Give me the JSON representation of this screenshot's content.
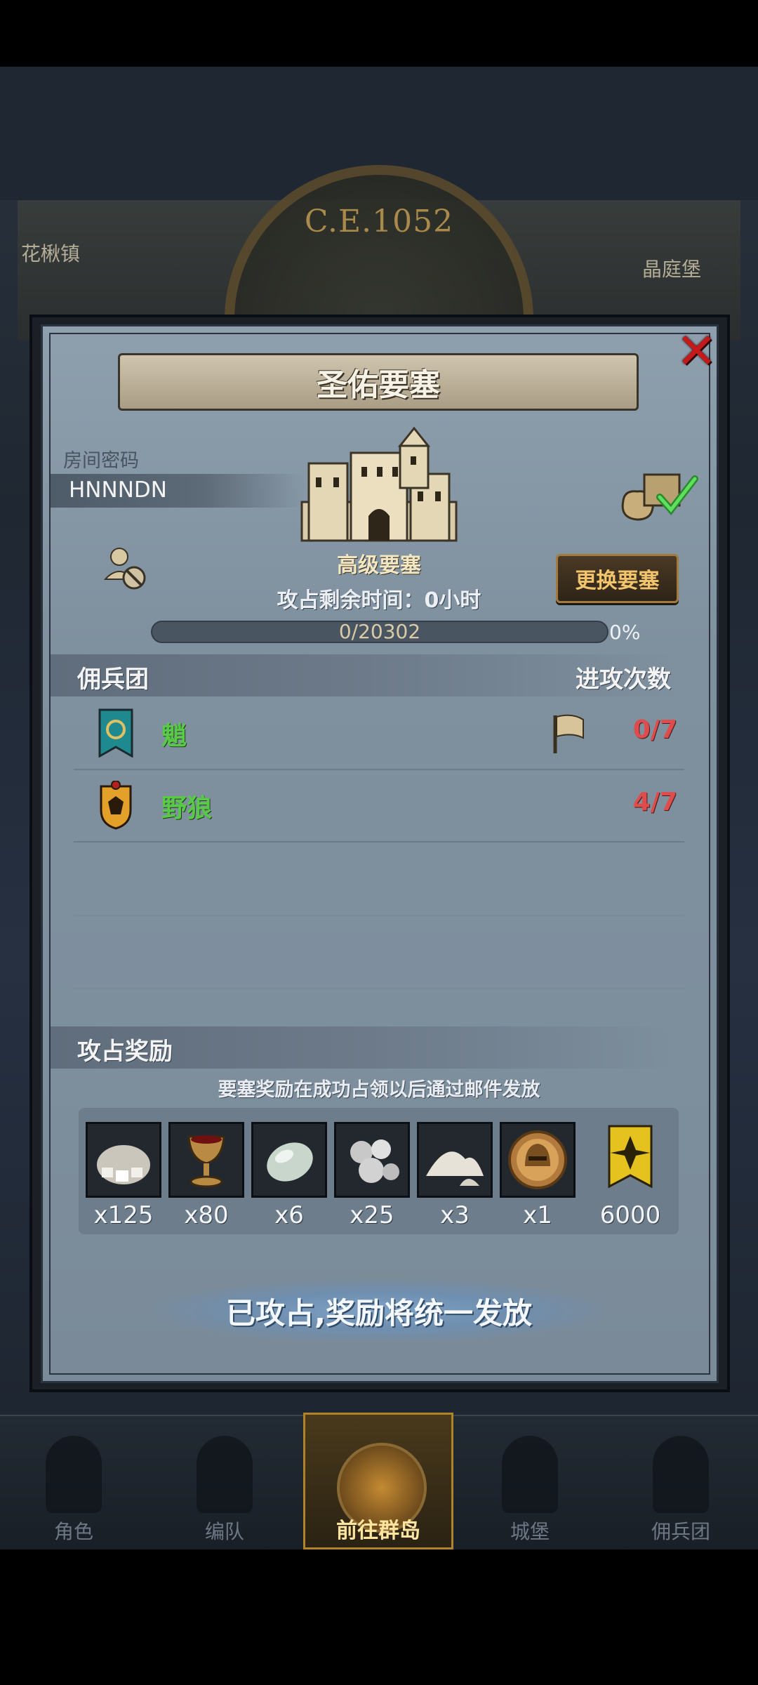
{
  "background": {
    "era": "C.E.1052",
    "town_left": "花楸镇",
    "town_right": "晶庭堡"
  },
  "dialog": {
    "title": "圣佑要塞",
    "room_code_label": "房间密码",
    "room_code": "HNNNDN",
    "fortress_level": "高级要塞",
    "change_fortress": "更换要塞",
    "time_remaining": "攻占剩余时间：0小时",
    "progress_text": "0/20302",
    "progress_percent": "0%",
    "progress_value": 0
  },
  "mercenaries": {
    "title": "佣兵团",
    "attack_count_title": "进攻次数",
    "rows": [
      {
        "name": "魈",
        "count": "0/7"
      },
      {
        "name": "野狼",
        "count": "4/7"
      }
    ]
  },
  "rewards": {
    "title": "攻占奖励",
    "note": "要塞奖励在成功占领以后通过邮件发放",
    "items": [
      {
        "icon": "stone-pile-icon",
        "qty": "x125"
      },
      {
        "icon": "goblet-icon",
        "qty": "x80"
      },
      {
        "icon": "moonstone-icon",
        "qty": "x6"
      },
      {
        "icon": "silver-ore-icon",
        "qty": "x25"
      },
      {
        "icon": "salt-pile-icon",
        "qty": "x3"
      },
      {
        "icon": "helmet-medal-icon",
        "qty": "x1"
      },
      {
        "icon": "guild-banner-icon",
        "qty": "6000"
      }
    ]
  },
  "claim_text": "已攻占,奖励将统一发放",
  "bottom_nav": [
    {
      "label": "角色",
      "icon": "character-icon"
    },
    {
      "label": "编队",
      "icon": "formation-icon"
    },
    {
      "label": "前往群岛",
      "icon": "islands-icon"
    },
    {
      "label": "城堡",
      "icon": "castle-icon"
    },
    {
      "label": "佣兵团",
      "icon": "mercenary-icon"
    }
  ],
  "colors": {
    "accent_gold": "#f2c46b",
    "merc_name_green": "#59c948",
    "count_red": "#de4c4c",
    "close_red": "#c51a1a"
  }
}
